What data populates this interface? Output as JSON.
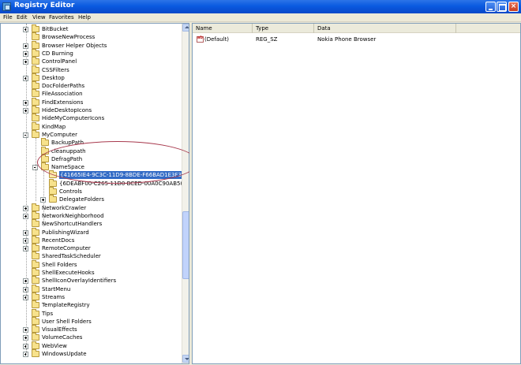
{
  "window": {
    "title": "Registry Editor"
  },
  "menu": [
    "File",
    "Edit",
    "View",
    "Favorites",
    "Help"
  ],
  "tree": {
    "items": [
      {
        "label": "BitBucket",
        "expander": "plus",
        "level": 1
      },
      {
        "label": "BrowseNewProcess",
        "expander": "none",
        "level": 1
      },
      {
        "label": "Browser Helper Objects",
        "expander": "plus",
        "level": 1
      },
      {
        "label": "CD Burning",
        "expander": "plus",
        "level": 1
      },
      {
        "label": "ControlPanel",
        "expander": "plus",
        "level": 1
      },
      {
        "label": "CSSFilters",
        "expander": "none",
        "level": 1
      },
      {
        "label": "Desktop",
        "expander": "plus",
        "level": 1
      },
      {
        "label": "DocFolderPaths",
        "expander": "none",
        "level": 1
      },
      {
        "label": "FileAssociation",
        "expander": "none",
        "level": 1
      },
      {
        "label": "FindExtensions",
        "expander": "plus",
        "level": 1
      },
      {
        "label": "HideDesktopIcons",
        "expander": "plus",
        "level": 1
      },
      {
        "label": "HideMyComputerIcons",
        "expander": "none",
        "level": 1
      },
      {
        "label": "KindMap",
        "expander": "none",
        "level": 1
      },
      {
        "label": "MyComputer",
        "expander": "minus",
        "level": 1
      },
      {
        "label": "BackupPath",
        "expander": "none",
        "level": 2
      },
      {
        "label": "cleanuppath",
        "expander": "none",
        "level": 2
      },
      {
        "label": "DefragPath",
        "expander": "none",
        "level": 2
      },
      {
        "label": "NameSpace",
        "expander": "minus",
        "level": 2
      },
      {
        "label": "{41665IE4-9C3C-11D9-8BDE-F66BAD1E3F3A}",
        "expander": "none",
        "level": 3,
        "selected": true
      },
      {
        "label": "{6DEABF00-C265-11D0-BCED-00A0C90AB50F}",
        "expander": "none",
        "level": 3
      },
      {
        "label": "Controls",
        "expander": "none",
        "level": 3
      },
      {
        "label": "DelegateFolders",
        "expander": "plus",
        "level": 3
      },
      {
        "label": "NetworkCrawler",
        "expander": "plus",
        "level": 1
      },
      {
        "label": "NetworkNeighborhood",
        "expander": "plus",
        "level": 1
      },
      {
        "label": "NewShortcutHandlers",
        "expander": "none",
        "level": 1
      },
      {
        "label": "PublishingWizard",
        "expander": "plus",
        "level": 1
      },
      {
        "label": "RecentDocs",
        "expander": "plus",
        "level": 1
      },
      {
        "label": "RemoteComputer",
        "expander": "plus",
        "level": 1
      },
      {
        "label": "SharedTaskScheduler",
        "expander": "none",
        "level": 1
      },
      {
        "label": "Shell Folders",
        "expander": "none",
        "level": 1
      },
      {
        "label": "ShellExecuteHooks",
        "expander": "none",
        "level": 1
      },
      {
        "label": "ShellIconOverlayIdentifiers",
        "expander": "plus",
        "level": 1
      },
      {
        "label": "StartMenu",
        "expander": "plus",
        "level": 1
      },
      {
        "label": "Streams",
        "expander": "plus",
        "level": 1
      },
      {
        "label": "TemplateRegistry",
        "expander": "none",
        "level": 1
      },
      {
        "label": "Tips",
        "expander": "none",
        "level": 1
      },
      {
        "label": "User Shell Folders",
        "expander": "none",
        "level": 1
      },
      {
        "label": "VisualEffects",
        "expander": "plus",
        "level": 1
      },
      {
        "label": "VolumeCaches",
        "expander": "plus",
        "level": 1
      },
      {
        "label": "WebView",
        "expander": "plus",
        "level": 1
      },
      {
        "label": "WindowsUpdate",
        "expander": "plus",
        "level": 1
      }
    ]
  },
  "list": {
    "columns": [
      "Name",
      "Type",
      "Data"
    ],
    "rows": [
      {
        "name": "(Default)",
        "type": "REG_SZ",
        "data": "Nokia Phone Browser"
      }
    ]
  },
  "colors": {
    "title_bar": "#0a5ae0",
    "selection": "#316ac5",
    "annotation_ellipse": "#a83a4e",
    "chrome": "#ece9d8"
  }
}
